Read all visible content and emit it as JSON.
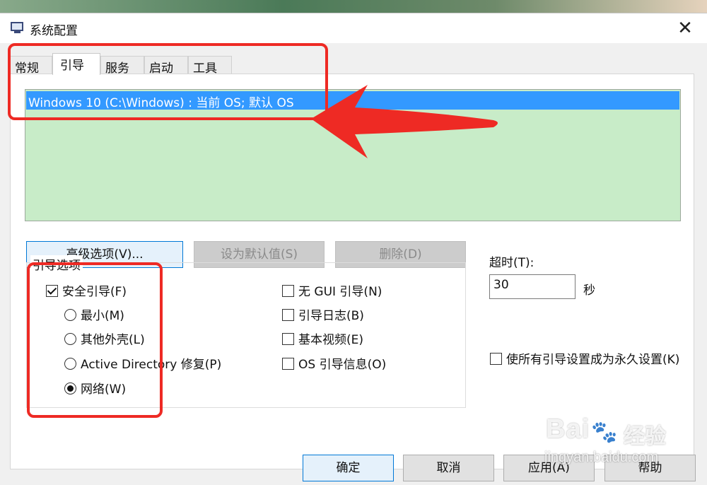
{
  "window": {
    "title": "系统配置",
    "close_glyph": "✕"
  },
  "tabs": [
    {
      "label": "常规"
    },
    {
      "label": "引导"
    },
    {
      "label": "服务"
    },
    {
      "label": "启动"
    },
    {
      "label": "工具"
    }
  ],
  "active_tab": "引导",
  "os_list": {
    "items": [
      "Windows 10 (C:\\Windows) : 当前 OS; 默认 OS"
    ],
    "selected_index": 0
  },
  "os_buttons": {
    "advanced": "高级选项(V)...",
    "set_default": "设为默认值(S)",
    "delete": "删除(D)"
  },
  "boot_options": {
    "group_label": "引导选项",
    "safe_boot": {
      "label": "安全引导(F)",
      "checked": true
    },
    "radios": [
      {
        "label": "最小(M)",
        "checked": false
      },
      {
        "label": "其他外壳(L)",
        "checked": false
      },
      {
        "label": "Active Directory 修复(P)",
        "checked": false
      },
      {
        "label": "网络(W)",
        "checked": true
      }
    ],
    "checkboxes": [
      {
        "label": "无 GUI 引导(N)",
        "checked": false
      },
      {
        "label": "引导日志(B)",
        "checked": false
      },
      {
        "label": "基本视频(E)",
        "checked": false
      },
      {
        "label": "OS 引导信息(O)",
        "checked": false
      }
    ]
  },
  "timeout": {
    "label": "超时(T):",
    "value": "30",
    "unit": "秒"
  },
  "permanent": {
    "label": "使所有引导设置成为永久设置(K)",
    "checked": false
  },
  "dialog_buttons": {
    "ok": "确定",
    "cancel": "取消",
    "apply": "应用(A)",
    "help": "帮助"
  },
  "watermark": {
    "brand": "Bai",
    "cn": "经验",
    "url": "jingyan.baidu.com"
  },
  "colors": {
    "selection": "#3399ff",
    "list_bg": "#c8ecc8",
    "annotation": "#ee2a24"
  }
}
